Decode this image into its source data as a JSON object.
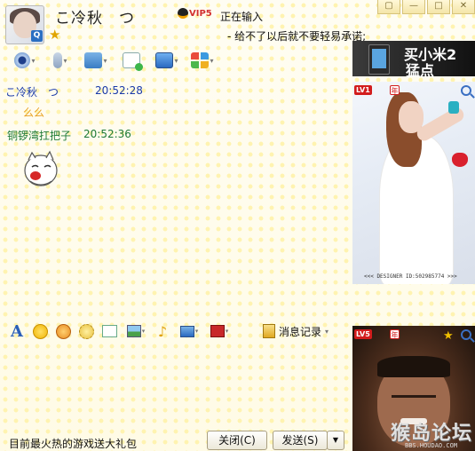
{
  "window": {
    "controls": [
      "▢",
      "—",
      "□",
      "✕"
    ]
  },
  "contact": {
    "nickname": "こ冷秋　つ",
    "status": "正在输入",
    "signature": "- 给不了以后就不要轻易承诺;",
    "vip_label": "VIP5",
    "badge": "Q"
  },
  "toolbar": {
    "items": [
      {
        "name": "video",
        "icon": "webcam-icon"
      },
      {
        "name": "voice",
        "icon": "microphone-icon"
      },
      {
        "name": "file",
        "icon": "folder-transfer-icon"
      },
      {
        "name": "sms",
        "icon": "sms-icon"
      },
      {
        "name": "remote",
        "icon": "remote-desktop-icon"
      },
      {
        "name": "apps",
        "icon": "apps-grid-icon"
      }
    ]
  },
  "ad": {
    "line1": "买小米2",
    "line2": "猛点"
  },
  "messages": [
    {
      "sender": "こ冷秋　つ",
      "time": "20:52:28",
      "text": "么么",
      "color": "#1a3aa8"
    },
    {
      "sender": "铜锣湾扛把子",
      "time": "20:52:36",
      "text": "",
      "sticker": "laughing-cat-sticker",
      "color": "#1d7a36"
    }
  ],
  "panel_top": {
    "level": "LV1",
    "year_badge": "年",
    "designer": "<<< DESIGNER ID:502985774 >>>"
  },
  "panel_bottom": {
    "level": "LV5",
    "year_badge": "年",
    "watermark": "猴岛论坛",
    "watermark_url": "BBS.HOUDAO.COM"
  },
  "input_toolbar": {
    "history_label": "消息记录"
  },
  "footer": {
    "promo": "目前最火热的游戏送大礼包",
    "close_label": "关闭(C)",
    "send_label": "发送(S)"
  },
  "colors": {
    "self_name": "#1a3aa8",
    "peer_name": "#1d7a36",
    "accent": "#e8a020"
  }
}
